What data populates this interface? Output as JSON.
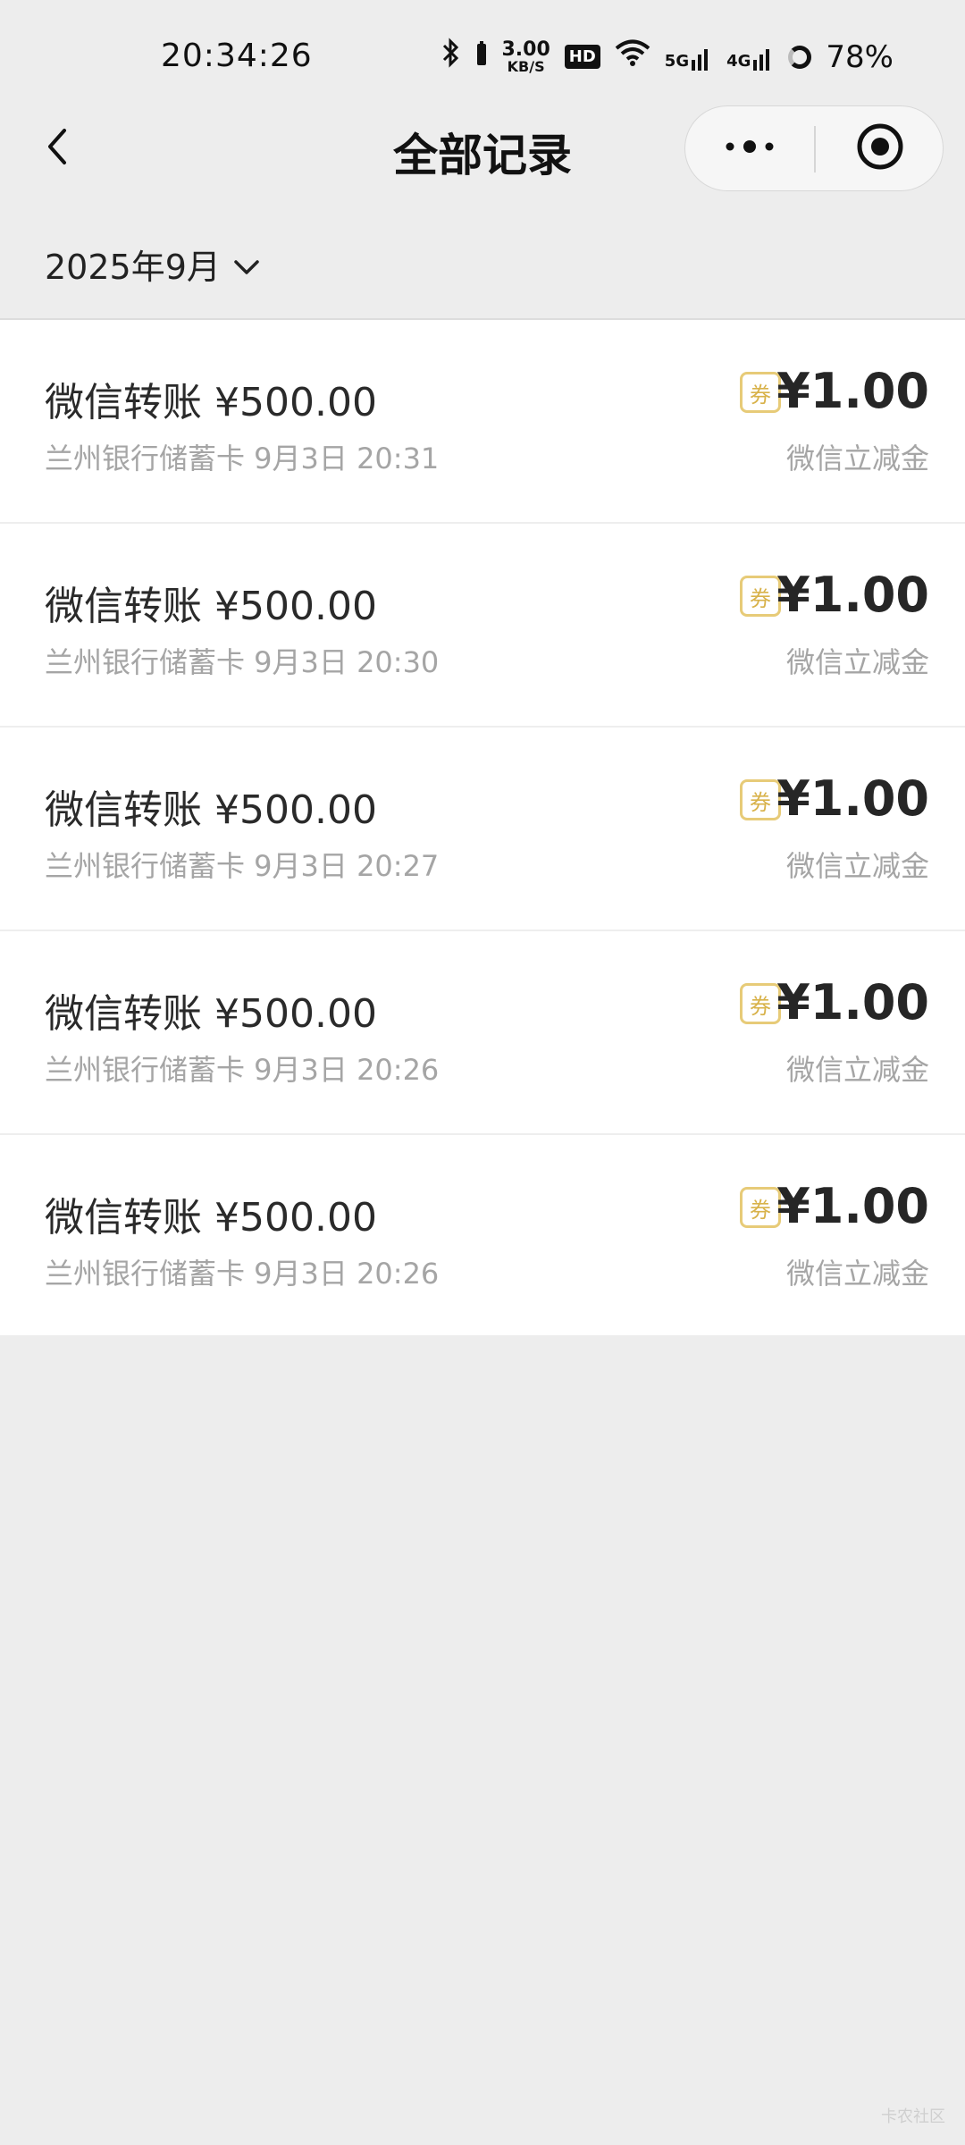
{
  "status_bar": {
    "time": "20:34:26",
    "net_speed_value": "3.00",
    "net_speed_unit": "KB/S",
    "hd_label": "HD",
    "signal_5g": "5G",
    "signal_4g": "4G",
    "battery": "78%",
    "icons": [
      "bluetooth-icon",
      "wifi-icon",
      "signal-icon",
      "battery-icon"
    ]
  },
  "nav": {
    "title": "全部记录",
    "back_icon": "chevron-left-icon",
    "more_icon": "more-dots-icon",
    "close_icon": "target-close-icon"
  },
  "filter": {
    "month": "2025年9月",
    "dropdown_icon": "chevron-down-icon"
  },
  "records": [
    {
      "title": "微信转账 ¥500.00",
      "sub": "兰州银行储蓄卡 9月3日 20:31",
      "coupon": "券",
      "amount": "¥1.00",
      "note": "微信立减金"
    },
    {
      "title": "微信转账 ¥500.00",
      "sub": "兰州银行储蓄卡 9月3日 20:30",
      "coupon": "券",
      "amount": "¥1.00",
      "note": "微信立减金"
    },
    {
      "title": "微信转账 ¥500.00",
      "sub": "兰州银行储蓄卡 9月3日 20:27",
      "coupon": "券",
      "amount": "¥1.00",
      "note": "微信立减金"
    },
    {
      "title": "微信转账 ¥500.00",
      "sub": "兰州银行储蓄卡 9月3日 20:26",
      "coupon": "券",
      "amount": "¥1.00",
      "note": "微信立减金"
    },
    {
      "title": "微信转账 ¥500.00",
      "sub": "兰州银行储蓄卡 9月3日 20:26",
      "coupon": "券",
      "amount": "¥1.00",
      "note": "微信立减金"
    }
  ],
  "watermark": "卡农社区",
  "colors": {
    "background": "#ededed",
    "card": "#ffffff",
    "coupon_gold": "#e7cb78",
    "secondary_text": "#a5a5a5"
  }
}
